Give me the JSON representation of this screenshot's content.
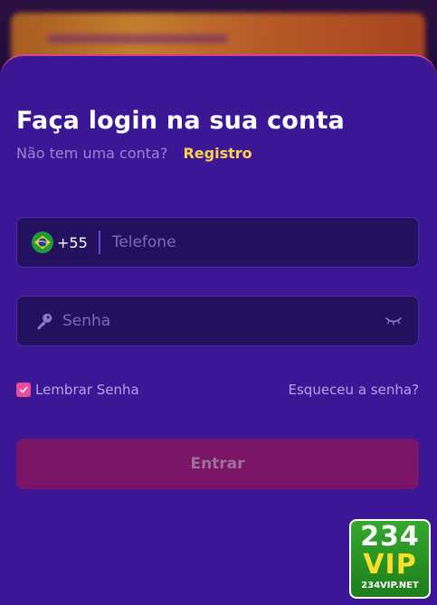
{
  "login": {
    "title": "Faça login na sua conta",
    "no_account_text": "Não tem uma conta?",
    "register_link": "Registro",
    "phone": {
      "country_flag": "brazil-flag-icon",
      "country_code": "+55",
      "value": "",
      "placeholder": "Telefone"
    },
    "password": {
      "value": "",
      "placeholder": "Senha"
    },
    "remember_label": "Lembrar Senha",
    "remember_checked": true,
    "forgot_link": "Esqueceu a senha?",
    "submit_label": "Entrar"
  },
  "logo": {
    "line1": "234",
    "line2": "VIP",
    "line3": "234VIP.NET"
  },
  "colors": {
    "sheet_bg": "#3c1795",
    "field_bg": "#23105e",
    "accent_pink": "#ec4a9c",
    "link_yellow": "#ffcf4d",
    "submit_bg": "#7a1466"
  }
}
